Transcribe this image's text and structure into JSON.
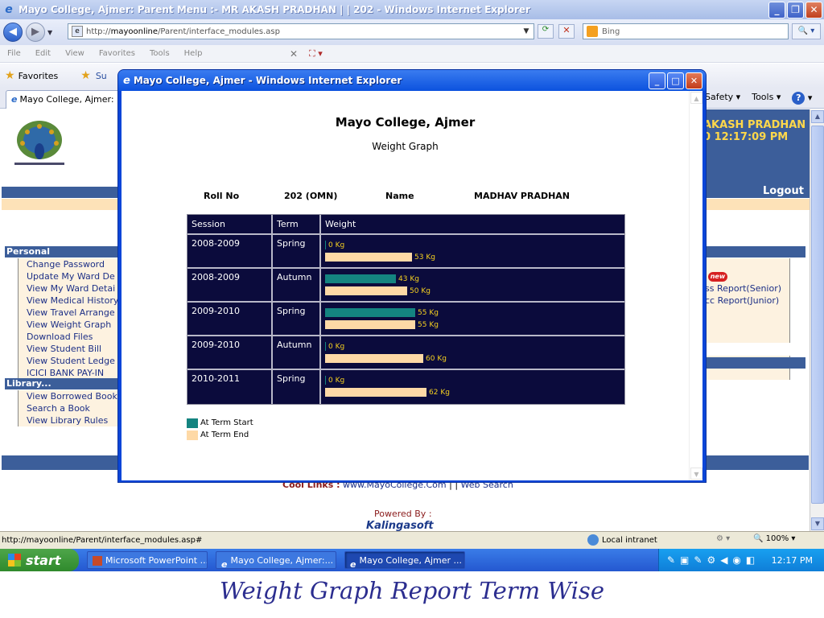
{
  "window": {
    "title": "Mayo College, Ajmer: Parent Menu :- MR AKASH PRADHAN | | 202 - Windows Internet Explorer",
    "address": "http://mayoonline/Parent/interface_modules.asp",
    "address_host": "mayoonline",
    "search_placeholder": "Bing",
    "menu": [
      "File",
      "Edit",
      "View",
      "Favorites",
      "Tools",
      "Help"
    ],
    "favorites_label": "Favorites",
    "suggested_label": "Su",
    "tab_label": "Mayo College, Ajmer: Pa",
    "command_bar": [
      "Safety",
      "Tools"
    ]
  },
  "page": {
    "user_name": "AKASH PRADHAN",
    "user_time": "0    12:17:09 PM",
    "logout": "Logout",
    "personal_heading": "Personal",
    "personal_items": [
      "Change Password",
      "Update My Ward De",
      "View My Ward Detai",
      "View Medical History",
      "View Travel Arrange",
      "View Weight Graph",
      "Download Files",
      "View Student Bill",
      "View Student Ledge",
      "ICICI BANK PAY-IN"
    ],
    "library_heading": "Library...",
    "library_items": [
      "View Borrowed Book",
      "Search a Book",
      "View Library Rules"
    ],
    "new_badge": "new",
    "right_items": [
      "ss Report(Senior)",
      "cc Report(Junior)"
    ],
    "cool_links_label": "Cool Links :",
    "cool_links_site": "www.MayoCollege.Com",
    "cool_links_sep": " | | ",
    "cool_links_search": "Web Search",
    "powered_by": "Powered By :",
    "powered_company": "Kalingasoft"
  },
  "popup": {
    "title": "Mayo College, Ajmer - Windows Internet Explorer",
    "heading": "Mayo College, Ajmer",
    "subheading": "Weight Graph",
    "roll_no_label": "Roll No",
    "roll_no": "202 (OMN)",
    "name_label": "Name",
    "name": "MADHAV PRADHAN",
    "columns": [
      "Session",
      "Term",
      "Weight"
    ],
    "unit": "Kg",
    "legend_start": "At Term Start",
    "legend_end": "At Term End"
  },
  "chart_data": {
    "type": "bar",
    "categories": [
      "2008-2009 Spring",
      "2008-2009 Autumn",
      "2009-2010 Spring",
      "2009-2010 Autumn",
      "2010-2011 Spring"
    ],
    "series": [
      {
        "name": "At Term Start",
        "values": [
          0,
          43,
          55,
          0,
          0
        ]
      },
      {
        "name": "At Term End",
        "values": [
          53,
          50,
          55,
          60,
          62
        ]
      }
    ],
    "rows": [
      {
        "session": "2008-2009",
        "term": "Spring",
        "start": 0,
        "end": 53
      },
      {
        "session": "2008-2009",
        "term": "Autumn",
        "start": 43,
        "end": 50
      },
      {
        "session": "2009-2010",
        "term": "Spring",
        "start": 55,
        "end": 55
      },
      {
        "session": "2009-2010",
        "term": "Autumn",
        "start": 0,
        "end": 60
      },
      {
        "session": "2010-2011",
        "term": "Spring",
        "start": 0,
        "end": 62
      }
    ],
    "xlabel": "",
    "ylabel": "Weight",
    "colors": {
      "start": "#148480",
      "end": "#fed9a6"
    }
  },
  "status_bar": {
    "url": "http://mayoonline/Parent/interface_modules.asp#",
    "zone": "Local intranet",
    "zoom": "100%"
  },
  "taskbar": {
    "start": "start",
    "items": [
      "Microsoft PowerPoint ...",
      "Mayo College, Ajmer:...",
      "Mayo College, Ajmer ..."
    ],
    "clock": "12:17 PM"
  },
  "caption": "Weight Graph Report Term Wise"
}
